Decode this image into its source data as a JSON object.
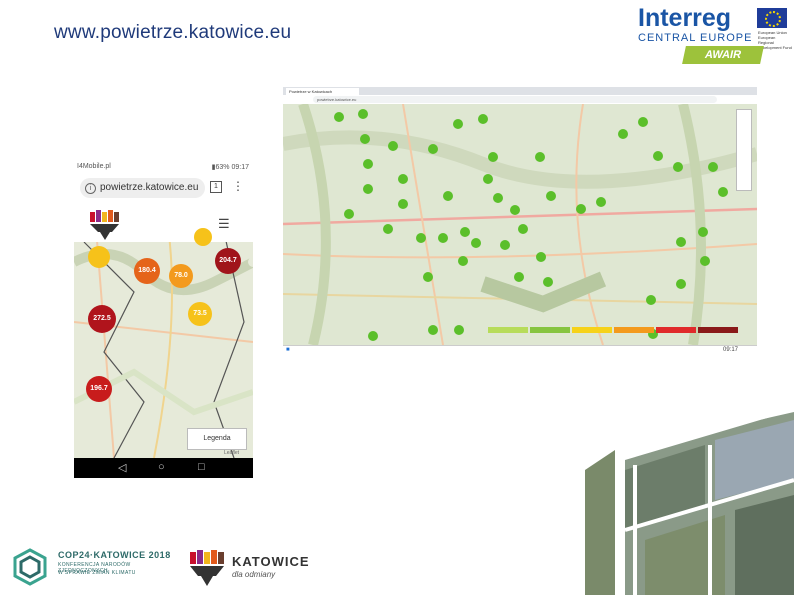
{
  "header": {
    "url_title": "www.powietrze.katowice.eu"
  },
  "interreg_logo": {
    "word": "Interreg",
    "subtitle": "CENTRAL EUROPE",
    "eu_text": "European Union European Regional Development Fund",
    "project": "AWAIR"
  },
  "phone": {
    "carrier": "I4Mobile.pl",
    "status_right": "▮63% 09:17",
    "address": "powietrze.katowice.eu",
    "tabs_count": "1",
    "menu_glyph": "⋮",
    "hamburger_glyph": "☰",
    "legend_label": "Legenda",
    "map_label": "Leaflet",
    "nav": {
      "back": "◁",
      "home": "○",
      "recent": "□"
    },
    "bubbles": [
      {
        "value": "",
        "color": "#f6c21a"
      },
      {
        "value": "",
        "color": "#f6c21a"
      },
      {
        "value": "204.7",
        "color": "#a0141a"
      },
      {
        "value": "180.4",
        "color": "#e5641a"
      },
      {
        "value": "78.0",
        "color": "#f39a1d"
      },
      {
        "value": "272.5",
        "color": "#b0141c"
      },
      {
        "value": "73.5",
        "color": "#f6c21a"
      },
      {
        "value": "196.7",
        "color": "#c81c1c"
      }
    ]
  },
  "desktop": {
    "tab_title": "Powietrze w Katowicach",
    "url": "powietrze.katowice.eu",
    "taskbar_time": "09:17",
    "legend_colors": [
      "#b7dc5a",
      "#86c440",
      "#f6d21a",
      "#f39a1d",
      "#e02b2b",
      "#8a1a1a"
    ],
    "bubble_color": "#5bbf2a"
  },
  "footer": {
    "cop_title": "COP24·KATOWICE 2018",
    "cop_line2": "KONFERENCJA NARODÓW ZJEDNOCZONYCH",
    "cop_line3": "W SPRAWIE ZMIAN KLIMATU",
    "katowice_title": "KATOWICE",
    "katowice_tagline": "dla odmiany"
  }
}
